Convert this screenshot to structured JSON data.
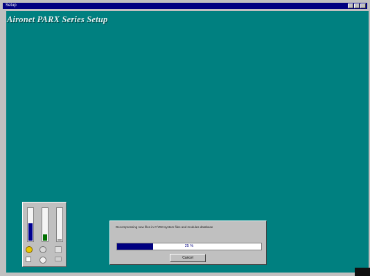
{
  "window": {
    "title": "Setup",
    "setup_title": "Aironet PARX Series Setup"
  },
  "colors": {
    "background": "#008080",
    "titlebar": "#000080",
    "progress": "#000080"
  },
  "icons": [
    "minimize-icon",
    "maximize-icon",
    "close-icon"
  ],
  "meters": {
    "disk_a_level": 0.55,
    "disk_b_level": 0.2,
    "disk_c_level": 0.05
  },
  "progress_dialog": {
    "status_text": "Decompressing new files in C:\\RM system files and modules database",
    "percent_label": "25 %",
    "percent": 25,
    "cancel_label": "Cancel"
  }
}
